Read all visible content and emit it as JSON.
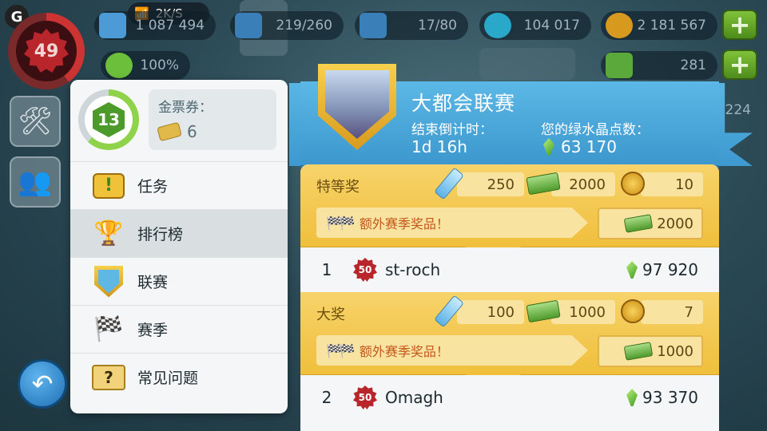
{
  "status": {
    "network_speed": "2K/S"
  },
  "player": {
    "level": "49",
    "happiness": "100%"
  },
  "resources": [
    {
      "name": "population",
      "value": "1 087 494",
      "color": "#4c9bd6"
    },
    {
      "name": "storage",
      "value": "219/260",
      "color": "#3a7fb8"
    },
    {
      "name": "vu-storage",
      "value": "17/80",
      "color": "#3a7fb8"
    },
    {
      "name": "neosimoleons",
      "value": "104 017",
      "color": "#2aa8c9"
    },
    {
      "name": "simoleons",
      "value": "2 181 567",
      "color": "#d79a1e"
    }
  ],
  "simcash": {
    "value": "281"
  },
  "side_value": "224",
  "menu": {
    "user_level": "13",
    "ticket_label": "金票券：",
    "ticket_count": "6",
    "items": [
      {
        "label": "任务",
        "icon": "task-icon"
      },
      {
        "label": "排行榜",
        "icon": "trophy-icon"
      },
      {
        "label": "联赛",
        "icon": "league-icon"
      },
      {
        "label": "赛季",
        "icon": "season-flags-icon"
      },
      {
        "label": "常见问题",
        "icon": "faq-icon"
      }
    ]
  },
  "contest": {
    "title": "大都会联赛",
    "countdown_label": "结束倒计时：",
    "countdown_value": "1d 16h",
    "points_label": "您的绿水晶点数：",
    "points_value": "63 170"
  },
  "tiers": [
    {
      "name": "特等奖",
      "keys": "250",
      "cash": "2000",
      "tokens": "10",
      "bonus_label": "额外赛季奖品！",
      "bonus_value": "2000"
    },
    {
      "name": "大奖",
      "keys": "100",
      "cash": "1000",
      "tokens": "7",
      "bonus_label": "额外赛季奖品！",
      "bonus_value": "1000"
    }
  ],
  "rankings": [
    {
      "rank": "1",
      "level": "50",
      "name": "st-roch",
      "points": "97 920"
    },
    {
      "rank": "2",
      "level": "50",
      "name": "Omagh",
      "points": "93 370"
    }
  ]
}
